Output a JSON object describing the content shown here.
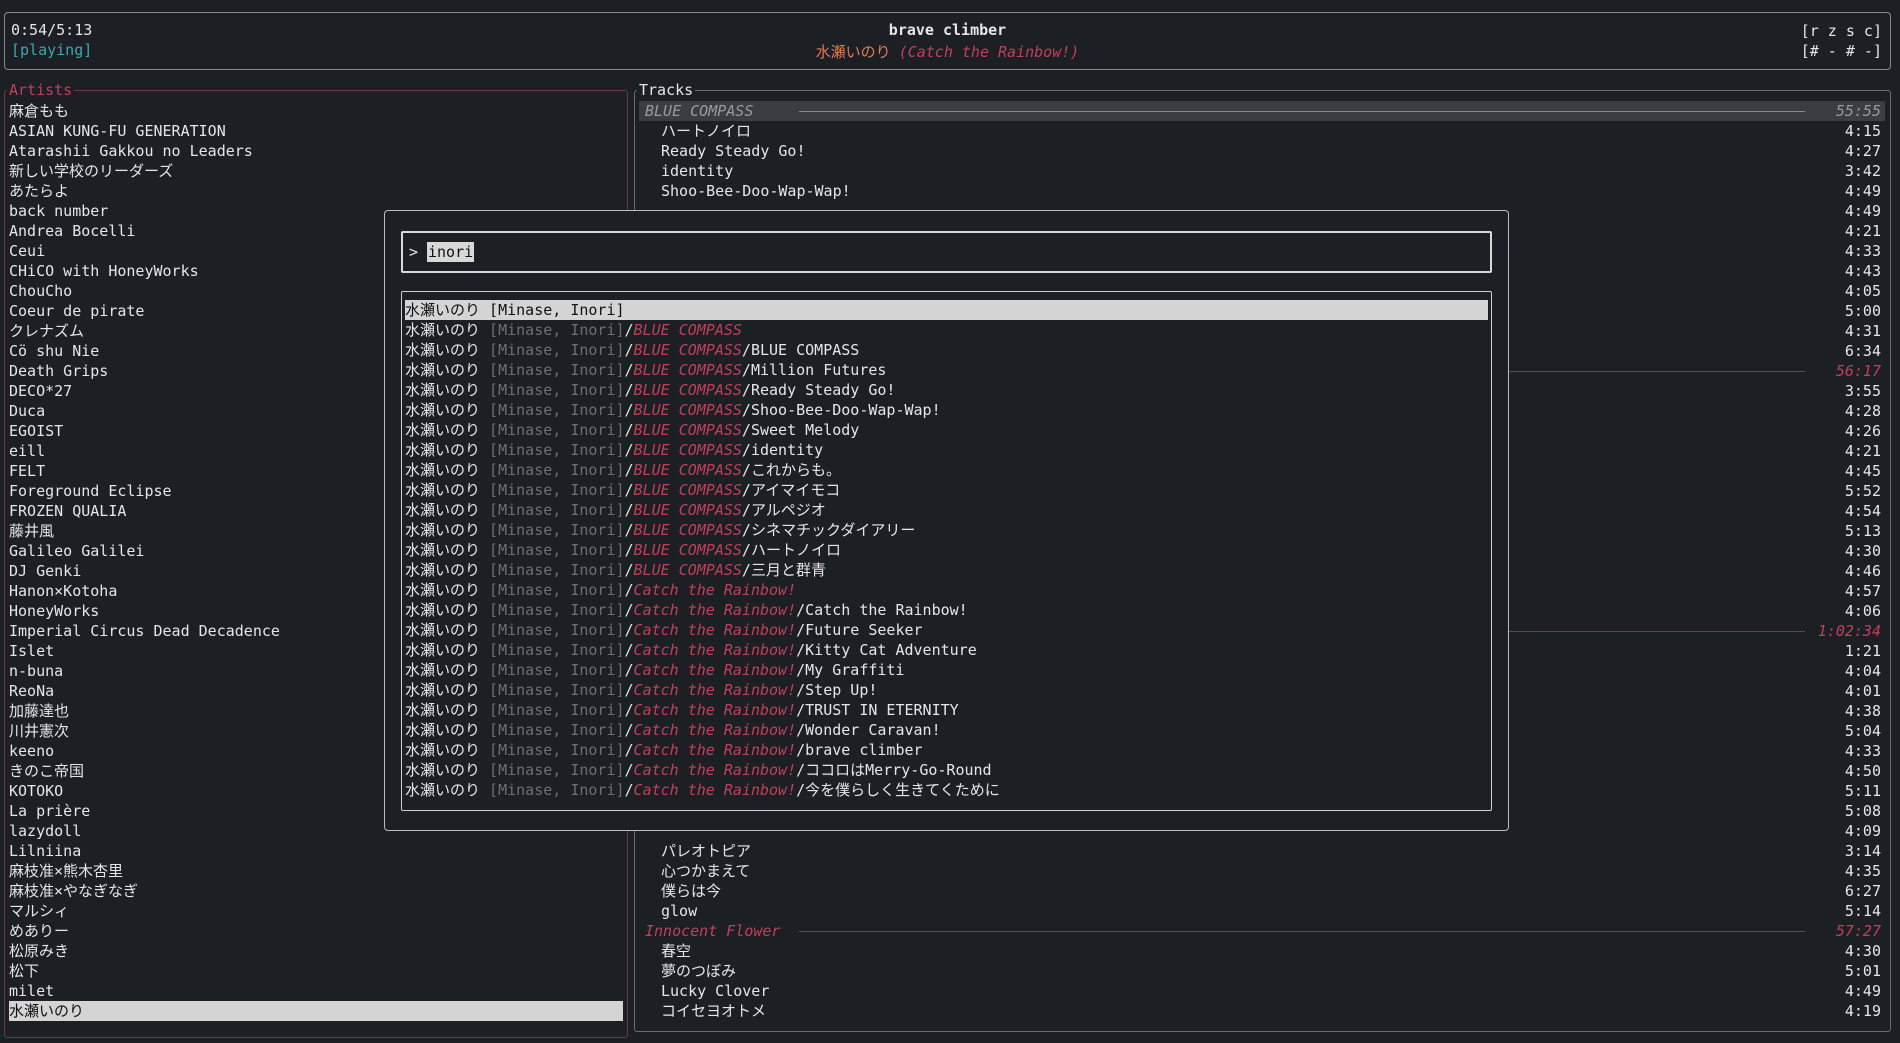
{
  "header": {
    "time": "0:54/5:13",
    "state": "[playing]",
    "title": "brave climber",
    "artist": "水瀬いのり",
    "album": "(Catch the Rainbow!)",
    "flags_line1": "[r z s c]",
    "flags_line2": "[# - # -]"
  },
  "artists_panel": {
    "title": "Artists",
    "items": [
      "麻倉もも",
      "ASIAN KUNG-FU GENERATION",
      "Atarashii Gakkou no Leaders",
      "新しい学校のリーダーズ",
      "あたらよ",
      "back number",
      "Andrea Bocelli",
      "Ceui",
      "CHiCO with HoneyWorks",
      "ChouCho",
      "Coeur de pirate",
      "クレナズム",
      "Cö shu Nie",
      "Death Grips",
      "DECO*27",
      "Duca",
      "EGOIST",
      "eill",
      "FELT",
      "Foreground Eclipse",
      "FROZEN QUALIA",
      "藤井風",
      "Galileo Galilei",
      "DJ Genki",
      "Hanon×Kotoha",
      "HoneyWorks",
      "Imperial Circus Dead Decadence",
      "Islet",
      "n-buna",
      "ReoNa",
      "加藤達也",
      "川井憲次",
      "keeno",
      "きのこ帝国",
      "KOTOKO",
      "La prière",
      "lazydoll",
      "Lilniina",
      "麻枝准×熊木杏里",
      "麻枝准×やなぎなぎ",
      "マルシィ",
      "めありー",
      "松原みき",
      "松下",
      "milet",
      "水瀬いのり"
    ],
    "selected_index": 45
  },
  "tracks_panel": {
    "title": "Tracks",
    "rows": [
      {
        "kind": "album",
        "name": "BLUE COMPASS",
        "dur": "55:55",
        "selected": true
      },
      {
        "kind": "track",
        "name": "ハートノイロ",
        "dur": "4:15"
      },
      {
        "kind": "track",
        "name": "Ready Steady Go!",
        "dur": "4:27"
      },
      {
        "kind": "track",
        "name": "identity",
        "dur": "3:42"
      },
      {
        "kind": "track",
        "name": "Shoo-Bee-Doo-Wap-Wap!",
        "dur": "4:49"
      },
      {
        "kind": "track",
        "name": "",
        "dur": "4:49"
      },
      {
        "kind": "track",
        "name": "",
        "dur": "4:21"
      },
      {
        "kind": "track",
        "name": "",
        "dur": "4:33"
      },
      {
        "kind": "track",
        "name": "",
        "dur": "4:43"
      },
      {
        "kind": "track",
        "name": "",
        "dur": "4:05"
      },
      {
        "kind": "track",
        "name": "",
        "dur": "5:00"
      },
      {
        "kind": "track",
        "name": "",
        "dur": "4:31"
      },
      {
        "kind": "track",
        "name": "",
        "dur": "6:34"
      },
      {
        "kind": "album",
        "name": "",
        "dur": "56:17"
      },
      {
        "kind": "track",
        "name": "",
        "dur": "3:55"
      },
      {
        "kind": "track",
        "name": "",
        "dur": "4:28"
      },
      {
        "kind": "track",
        "name": "",
        "dur": "4:26"
      },
      {
        "kind": "track",
        "name": "",
        "dur": "4:21"
      },
      {
        "kind": "track",
        "name": "",
        "dur": "4:45"
      },
      {
        "kind": "track",
        "name": "",
        "dur": "5:52"
      },
      {
        "kind": "track",
        "name": "",
        "dur": "4:54"
      },
      {
        "kind": "track",
        "name": "",
        "dur": "5:13"
      },
      {
        "kind": "track",
        "name": "",
        "dur": "4:30"
      },
      {
        "kind": "track",
        "name": "",
        "dur": "4:46"
      },
      {
        "kind": "track",
        "name": "",
        "dur": "4:57"
      },
      {
        "kind": "track",
        "name": "",
        "dur": "4:06"
      },
      {
        "kind": "album",
        "name": "",
        "dur": "1:02:34"
      },
      {
        "kind": "track",
        "name": "",
        "dur": "1:21"
      },
      {
        "kind": "track",
        "name": "",
        "dur": "4:04"
      },
      {
        "kind": "track",
        "name": "",
        "dur": "4:01"
      },
      {
        "kind": "track",
        "name": "",
        "dur": "4:38"
      },
      {
        "kind": "track",
        "name": "",
        "dur": "5:04"
      },
      {
        "kind": "track",
        "name": "",
        "dur": "4:33"
      },
      {
        "kind": "track",
        "name": "",
        "dur": "4:50"
      },
      {
        "kind": "track",
        "name": "",
        "dur": "5:11"
      },
      {
        "kind": "track",
        "name": "",
        "dur": "5:08"
      },
      {
        "kind": "track",
        "name": "",
        "dur": "4:09"
      },
      {
        "kind": "track",
        "name": "パレオトピア",
        "dur": "3:14"
      },
      {
        "kind": "track",
        "name": "心つかまえて",
        "dur": "4:35"
      },
      {
        "kind": "track",
        "name": "僕らは今",
        "dur": "6:27"
      },
      {
        "kind": "track",
        "name": "glow",
        "dur": "5:14"
      },
      {
        "kind": "album",
        "name": "Innocent Flower",
        "dur": "57:27"
      },
      {
        "kind": "track",
        "name": "春空",
        "dur": "4:30"
      },
      {
        "kind": "track",
        "name": "夢のつぼみ",
        "dur": "5:01"
      },
      {
        "kind": "track",
        "name": "Lucky Clover",
        "dur": "4:49"
      },
      {
        "kind": "track",
        "name": "コイセヨオトメ",
        "dur": "4:19"
      }
    ]
  },
  "search": {
    "prompt": ">",
    "query": "inori",
    "results": [
      {
        "artist": "水瀬いのり",
        "alias": "[Minase, Inori]",
        "album": "",
        "track": "",
        "selected": true
      },
      {
        "artist": "水瀬いのり",
        "alias": "[Minase, Inori]",
        "album": "BLUE COMPASS",
        "track": ""
      },
      {
        "artist": "水瀬いのり",
        "alias": "[Minase, Inori]",
        "album": "BLUE COMPASS",
        "track": "BLUE COMPASS"
      },
      {
        "artist": "水瀬いのり",
        "alias": "[Minase, Inori]",
        "album": "BLUE COMPASS",
        "track": "Million Futures"
      },
      {
        "artist": "水瀬いのり",
        "alias": "[Minase, Inori]",
        "album": "BLUE COMPASS",
        "track": "Ready Steady Go!"
      },
      {
        "artist": "水瀬いのり",
        "alias": "[Minase, Inori]",
        "album": "BLUE COMPASS",
        "track": "Shoo-Bee-Doo-Wap-Wap!"
      },
      {
        "artist": "水瀬いのり",
        "alias": "[Minase, Inori]",
        "album": "BLUE COMPASS",
        "track": "Sweet Melody"
      },
      {
        "artist": "水瀬いのり",
        "alias": "[Minase, Inori]",
        "album": "BLUE COMPASS",
        "track": "identity"
      },
      {
        "artist": "水瀬いのり",
        "alias": "[Minase, Inori]",
        "album": "BLUE COMPASS",
        "track": "これからも。"
      },
      {
        "artist": "水瀬いのり",
        "alias": "[Minase, Inori]",
        "album": "BLUE COMPASS",
        "track": "アイマイモコ"
      },
      {
        "artist": "水瀬いのり",
        "alias": "[Minase, Inori]",
        "album": "BLUE COMPASS",
        "track": "アルペジオ"
      },
      {
        "artist": "水瀬いのり",
        "alias": "[Minase, Inori]",
        "album": "BLUE COMPASS",
        "track": "シネマチックダイアリー"
      },
      {
        "artist": "水瀬いのり",
        "alias": "[Minase, Inori]",
        "album": "BLUE COMPASS",
        "track": "ハートノイロ"
      },
      {
        "artist": "水瀬いのり",
        "alias": "[Minase, Inori]",
        "album": "BLUE COMPASS",
        "track": "三月と群青"
      },
      {
        "artist": "水瀬いのり",
        "alias": "[Minase, Inori]",
        "album": "Catch the Rainbow!",
        "track": ""
      },
      {
        "artist": "水瀬いのり",
        "alias": "[Minase, Inori]",
        "album": "Catch the Rainbow!",
        "track": "Catch the Rainbow!"
      },
      {
        "artist": "水瀬いのり",
        "alias": "[Minase, Inori]",
        "album": "Catch the Rainbow!",
        "track": "Future Seeker"
      },
      {
        "artist": "水瀬いのり",
        "alias": "[Minase, Inori]",
        "album": "Catch the Rainbow!",
        "track": "Kitty Cat Adventure"
      },
      {
        "artist": "水瀬いのり",
        "alias": "[Minase, Inori]",
        "album": "Catch the Rainbow!",
        "track": "My Graffiti"
      },
      {
        "artist": "水瀬いのり",
        "alias": "[Minase, Inori]",
        "album": "Catch the Rainbow!",
        "track": "Step Up!"
      },
      {
        "artist": "水瀬いのり",
        "alias": "[Minase, Inori]",
        "album": "Catch the Rainbow!",
        "track": "TRUST IN ETERNITY"
      },
      {
        "artist": "水瀬いのり",
        "alias": "[Minase, Inori]",
        "album": "Catch the Rainbow!",
        "track": "Wonder Caravan!"
      },
      {
        "artist": "水瀬いのり",
        "alias": "[Minase, Inori]",
        "album": "Catch the Rainbow!",
        "track": "brave climber"
      },
      {
        "artist": "水瀬いのり",
        "alias": "[Minase, Inori]",
        "album": "Catch the Rainbow!",
        "track": "ココロはMerry-Go-Round"
      },
      {
        "artist": "水瀬いのり",
        "alias": "[Minase, Inori]",
        "album": "Catch the Rainbow!",
        "track": "今を僕らしく生きてくために"
      }
    ]
  }
}
